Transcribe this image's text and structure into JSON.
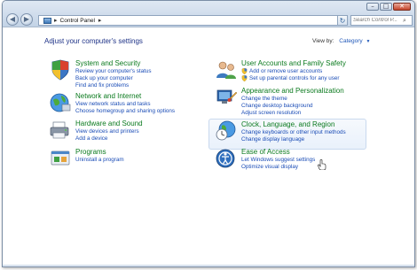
{
  "toolbar": {
    "address_crumb": "Control Panel",
    "search_placeholder": "Search Control P..."
  },
  "page": {
    "heading": "Adjust your computer's settings",
    "view_by_label": "View by:",
    "view_by_value": "Category"
  },
  "categories": {
    "system_security": {
      "title": "System and Security",
      "links": [
        "Review your computer's status",
        "Back up your computer",
        "Find and fix problems"
      ]
    },
    "network_internet": {
      "title": "Network and Internet",
      "links": [
        "View network status and tasks",
        "Choose homegroup and sharing options"
      ]
    },
    "hardware_sound": {
      "title": "Hardware and Sound",
      "links": [
        "View devices and printers",
        "Add a device"
      ]
    },
    "programs": {
      "title": "Programs",
      "links": [
        "Uninstall a program"
      ]
    },
    "user_accounts": {
      "title": "User Accounts and Family Safety",
      "links": [
        "Add or remove user accounts",
        "Set up parental controls for any user"
      ]
    },
    "appearance": {
      "title": "Appearance and Personalization",
      "links": [
        "Change the theme",
        "Change desktop background",
        "Adjust screen resolution"
      ]
    },
    "clock_region": {
      "title": "Clock, Language, and Region",
      "links": [
        "Change keyboards or other input methods",
        "Change display language"
      ]
    },
    "ease_access": {
      "title": "Ease of Access",
      "links": [
        "Let Windows suggest settings",
        "Optimize visual display"
      ]
    }
  },
  "colors": {
    "category_title": "#0b7a1e",
    "link": "#1a4cb6",
    "heading": "#1e3287"
  },
  "icons": [
    "back-icon",
    "forward-icon",
    "control-panel-icon",
    "refresh-icon",
    "search-icon",
    "minimize-icon",
    "maximize-icon",
    "close-icon",
    "shield-icon"
  ]
}
